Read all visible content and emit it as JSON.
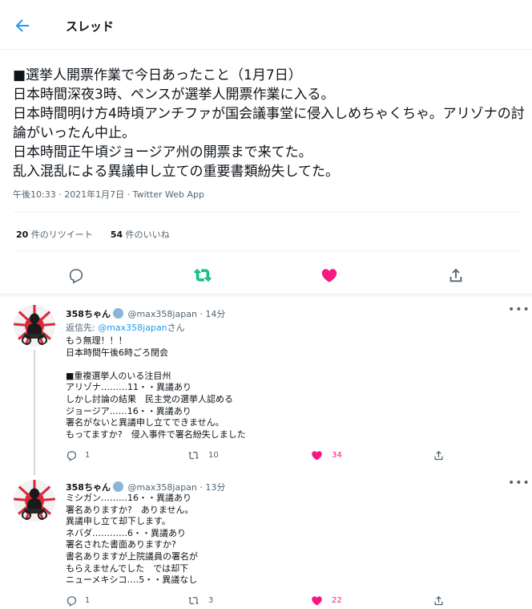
{
  "header": {
    "title": "スレッド"
  },
  "tweet": {
    "body": "■選挙人開票作業で今日あったこと（1月7日）\n日本時間深夜3時、ペンスが選挙人開票作業に入る。\n日本時間明け方4時頃アンチファが国会議事堂に侵入しめちゃくちゃ。アリゾナの討論がいったん中止。\n日本時間正午頃ジョージア州の開票まで来てた。\n乱入混乱による異議申し立ての重要書類紛失してた。",
    "meta": "午後10:33 · 2021年1月7日 · Twitter Web App",
    "retweets_count": "20",
    "retweets_label": "件のリツイート",
    "likes_count": "54",
    "likes_label": "件のいいね"
  },
  "replies": [
    {
      "name": "358ちゃん",
      "handle": "@max358japan",
      "time": "· 14分",
      "reply_to_prefix": "返信先: ",
      "reply_to_handle": "@max358japan",
      "reply_to_suffix": "さん",
      "text": "もう無理！！！\n日本時間午後6時ごろ閉会\n\n■重複選挙人のいる注目州\nアリゾナ………11・・異議あり\nしかし討論の結果　民主党の選挙人認める\nジョージア……16・・異議あり\n署名がないと異議申し立てできません。\nもってますか?　侵入事件で署名紛失しました",
      "reply_count": "1",
      "retweet_count": "10",
      "like_count": "34"
    },
    {
      "name": "358ちゃん",
      "handle": "@max358japan",
      "time": "· 13分",
      "text": "ミシガン………16・・異議あり\n署名ありますか?　ありません。\n異議申し立て却下します。\nネバダ…………6・・異議あり\n署名された書面ありますか?\n書名ありますが上院議員の署名が\nもらえませんでした　では却下\nニューメキシコ‥‥5・・異議なし",
      "reply_count": "1",
      "retweet_count": "3",
      "like_count": "22"
    }
  ],
  "colors": {
    "accent": "#1d9bf0",
    "retweet": "#00ba7c",
    "like": "#f91880",
    "muted": "#536471"
  }
}
